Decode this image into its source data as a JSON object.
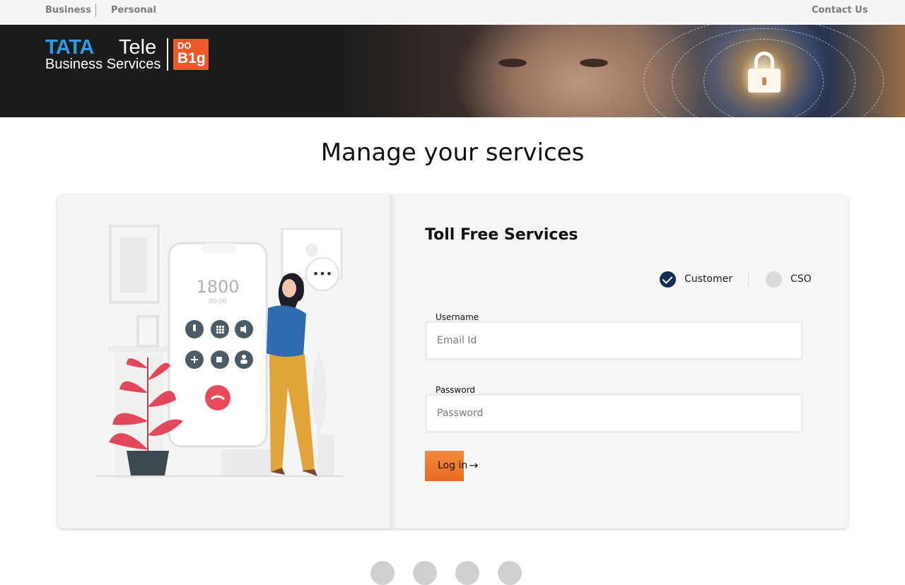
{
  "topbar": {
    "business": "Business",
    "personal": "Personal",
    "contact": "Contact Us"
  },
  "brand": {
    "tata": "TATA",
    "tele": "Tele",
    "business_services": "Business Services",
    "badge_line1": "DO",
    "badge_line2": "B1g",
    "badge_color": "#ea5a2a",
    "tata_color": "#2e9be5"
  },
  "page": {
    "title": "Manage your services"
  },
  "illustration": {
    "phone_number": "1800",
    "call_timer": "00:00",
    "bubble_text": "•••",
    "phone_icons": [
      "mic-icon",
      "keypad-icon",
      "speaker-icon",
      "plus-icon",
      "video-icon",
      "contact-icon",
      "end-call-icon"
    ]
  },
  "form": {
    "title": "Toll Free Services",
    "role_customer": "Customer",
    "role_cso": "CSO",
    "username_label": "Username",
    "username_placeholder": "Email Id",
    "password_label": "Password",
    "password_placeholder": "Password",
    "login_label": "Log in",
    "login_arrow": "→",
    "accent_color": "#ec6a22",
    "selected_color": "#0f2f58"
  }
}
